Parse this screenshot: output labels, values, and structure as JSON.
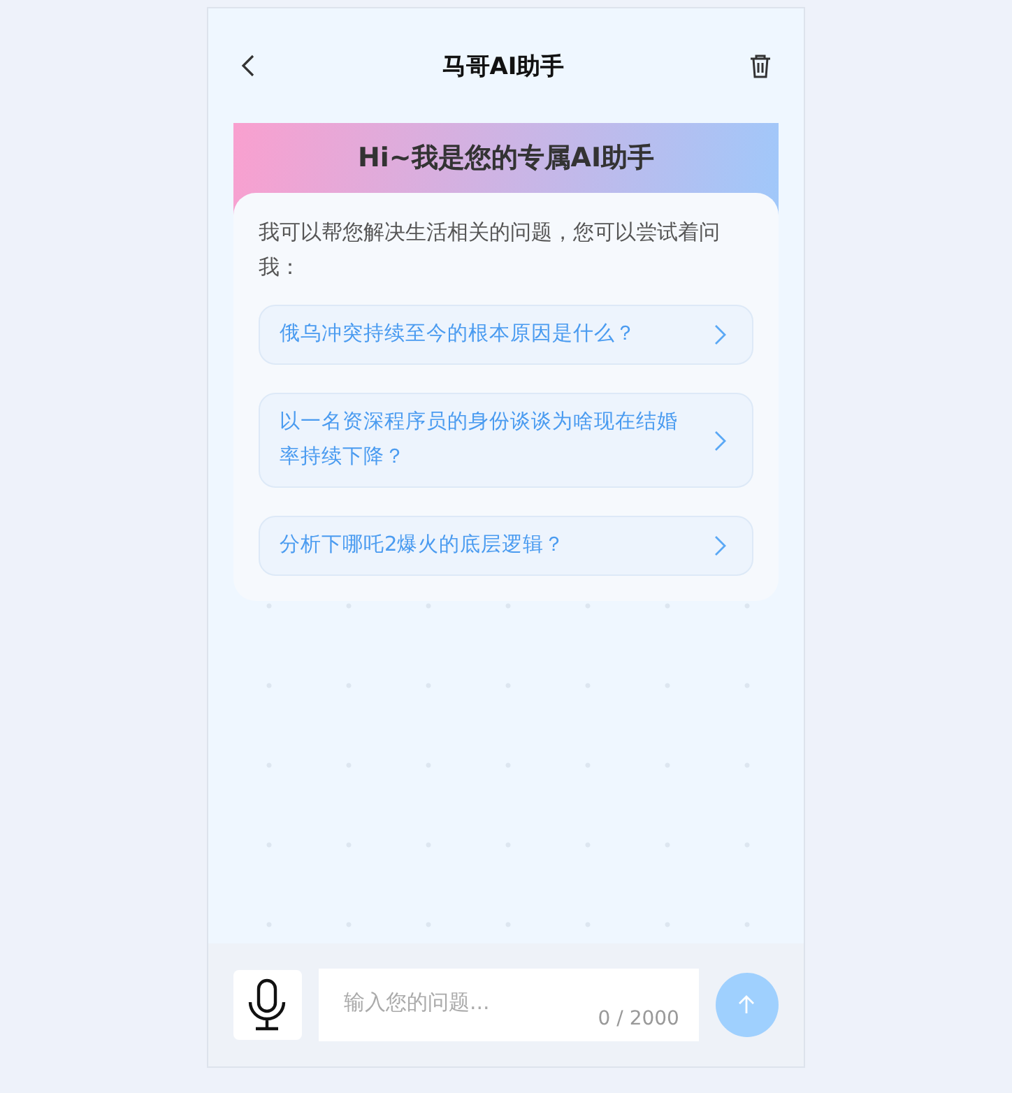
{
  "header": {
    "title": "马哥AI助手"
  },
  "welcome": {
    "title": "Hi~我是您的专属AI助手",
    "intro": "我可以帮您解决生活相关的问题，您可以尝试着问我：",
    "suggestions": [
      {
        "text": "俄乌冲突持续至今的根本原因是什么？"
      },
      {
        "text": "以一名资深程序员的身份谈谈为啥现在结婚率持续下降？"
      },
      {
        "text": "分析下哪吒2爆火的底层逻辑？"
      }
    ]
  },
  "composer": {
    "placeholder": "输入您的问题...",
    "counter": "0 / 2000"
  }
}
